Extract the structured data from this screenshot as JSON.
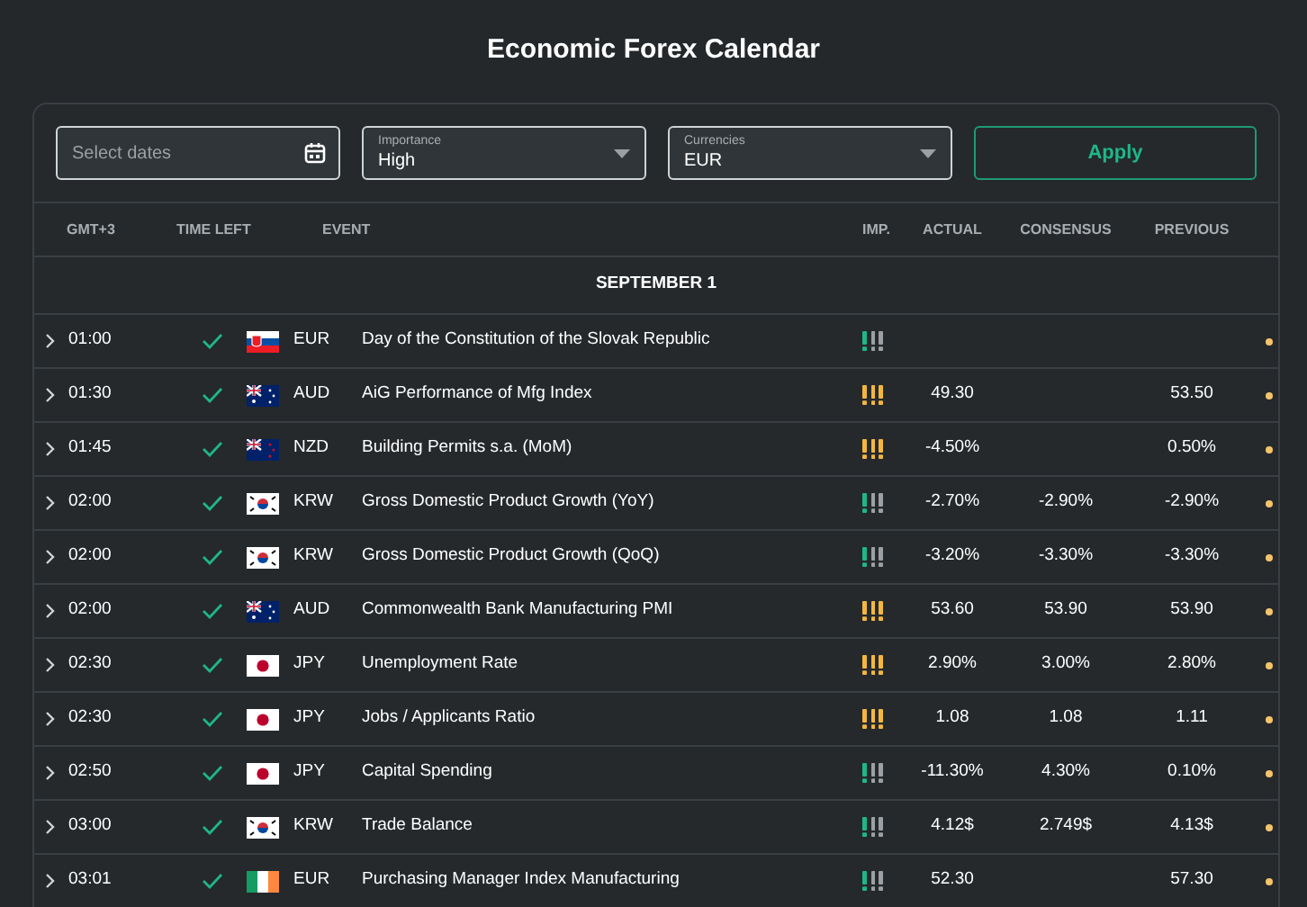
{
  "title": "Economic Forex Calendar",
  "filters": {
    "dates": {
      "placeholder": "Select dates"
    },
    "importance": {
      "label": "Importance",
      "value": "High"
    },
    "currencies": {
      "label": "Currencies",
      "value": "EUR"
    },
    "apply": "Apply"
  },
  "table": {
    "columns": [
      "GMT+3",
      "TIME LEFT",
      "EVENT",
      "IMP.",
      "ACTUAL",
      "CONSENSUS",
      "PREVIOUS"
    ],
    "date": "SEPTEMBER 1",
    "rows": [
      {
        "time": "01:00",
        "passed": true,
        "kind": "slovakia",
        "currency": "EUR",
        "event": "Day of the Constitution of the Slovak Republic",
        "importance": {
          "kind": "low"
        }
      },
      {
        "time": "01:30",
        "passed": true,
        "kind": "australia",
        "currency": "AUD",
        "event": "AiG Performance of Mfg Index",
        "importance": {
          "kind": "high"
        },
        "actual": "49.30",
        "previous": "53.50"
      },
      {
        "time": "01:45",
        "passed": true,
        "kind": "newzealand",
        "currency": "NZD",
        "event": "Building Permits s.a. (MoM)",
        "importance": {
          "kind": "high"
        },
        "actual": "-4.50%",
        "previous": "0.50%"
      },
      {
        "time": "02:00",
        "passed": true,
        "kind": "korea",
        "currency": "KRW",
        "event": "Gross Domestic Product Growth (YoY)",
        "importance": {
          "kind": "low"
        },
        "actual": "-2.70%",
        "consensus": "-2.90%",
        "previous": "-2.90%"
      },
      {
        "time": "02:00",
        "passed": true,
        "kind": "korea",
        "currency": "KRW",
        "event": "Gross Domestic Product Growth (QoQ)",
        "importance": {
          "kind": "low"
        },
        "actual": "-3.20%",
        "consensus": "-3.30%",
        "previous": "-3.30%"
      },
      {
        "time": "02:00",
        "passed": true,
        "kind": "australia",
        "currency": "AUD",
        "event": "Commonwealth Bank Manufacturing PMI",
        "importance": {
          "kind": "high"
        },
        "actual": "53.60",
        "consensus": "53.90",
        "previous": "53.90"
      },
      {
        "time": "02:30",
        "passed": true,
        "kind": "japan",
        "currency": "JPY",
        "event": "Unemployment Rate",
        "importance": {
          "kind": "high"
        },
        "actual": "2.90%",
        "consensus": "3.00%",
        "previous": "2.80%"
      },
      {
        "time": "02:30",
        "passed": true,
        "kind": "japan",
        "currency": "JPY",
        "event": "Jobs / Applicants Ratio",
        "importance": {
          "kind": "high"
        },
        "actual": "1.08",
        "consensus": "1.08",
        "previous": "1.11"
      },
      {
        "time": "02:50",
        "passed": true,
        "kind": "japan",
        "currency": "JPY",
        "event": "Capital Spending",
        "importance": {
          "kind": "low"
        },
        "actual": "-11.30%",
        "consensus": "4.30%",
        "previous": "0.10%"
      },
      {
        "time": "03:00",
        "passed": true,
        "kind": "korea",
        "currency": "KRW",
        "event": "Trade Balance",
        "importance": {
          "kind": "low"
        },
        "actual": "4.12$",
        "consensus": "2.749$",
        "previous": "4.13$"
      },
      {
        "time": "03:01",
        "passed": true,
        "kind": "ireland",
        "currency": "EUR",
        "event": "Purchasing Manager Index Manufacturing",
        "importance": {
          "kind": "low"
        },
        "actual": "52.30",
        "previous": "57.30"
      }
    ]
  }
}
